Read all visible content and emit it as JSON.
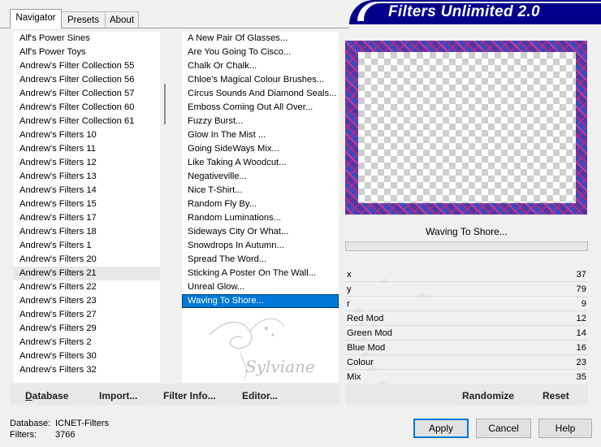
{
  "tabs": [
    {
      "label": "Navigator",
      "active": true
    },
    {
      "label": "Presets",
      "active": false
    },
    {
      "label": "About",
      "active": false
    }
  ],
  "banner": {
    "title": "Filters Unlimited 2.0"
  },
  "categories": {
    "items": [
      "Alf's Power Sines",
      "Alf's Power Toys",
      "Andrew's Filter Collection 55",
      "Andrew's Filter Collection 56",
      "Andrew's Filter Collection 57",
      "Andrew's Filter Collection 60",
      "Andrew's Filter Collection 61",
      "Andrew's Filters 10",
      "Andrew's Filters 11",
      "Andrew's Filters 12",
      "Andrew's Filters 13",
      "Andrew's Filters 14",
      "Andrew's Filters 15",
      "Andrew's Filters 17",
      "Andrew's Filters 18",
      "Andrew's Filters 1",
      "Andrew's Filters 20",
      "Andrew's Filters 21",
      "Andrew's Filters 22",
      "Andrew's Filters 23",
      "Andrew's Filters 27",
      "Andrew's Filters 29",
      "Andrew's Filters 2",
      "Andrew's Filters 30",
      "Andrew's Filters 32"
    ],
    "selected": "Andrew's Filters 21"
  },
  "filters": {
    "items": [
      "A New Pair Of Glasses...",
      "Are You Going To Cisco...",
      "Chalk Or Chalk...",
      "Chloe's Magical Colour Brushes...",
      "Circus Sounds And Diamond Seals...",
      "Emboss Coming Out All Over...",
      "Fuzzy Burst...",
      "Glow In The Mist ...",
      "Going SideWays Mix...",
      "Like Taking A Woodcut...",
      "Negativeville...",
      "Nice T-Shirt...",
      "Random Fly By...",
      "Random Luminations...",
      "Sideways City Or What...",
      "Snowdrops In Autumn...",
      "Spread The Word...",
      "Sticking A Poster On The Wall...",
      "Unreal Glow...",
      "Waving To Shore..."
    ],
    "selected": "Waving To Shore..."
  },
  "watermark": "Sylviane",
  "preview": {
    "filter_name": "Waving To Shore..."
  },
  "params": [
    {
      "label": "x",
      "value": "37",
      "fraction": 0.145
    },
    {
      "label": "y",
      "value": "79",
      "fraction": 0.31
    },
    {
      "label": "r",
      "value": "9",
      "fraction": 0.035
    },
    {
      "label": "Red Mod",
      "value": "12",
      "fraction": 0.047
    },
    {
      "label": "Green Mod",
      "value": "14",
      "fraction": 0.055
    },
    {
      "label": "Blue Mod",
      "value": "16",
      "fraction": 0.063
    },
    {
      "label": "Colour",
      "value": "23",
      "fraction": 0.09
    },
    {
      "label": "Mix",
      "value": "35",
      "fraction": 0.137
    }
  ],
  "buttons": {
    "database": "Database",
    "import": "Import...",
    "filter_info": "Filter Info...",
    "editor": "Editor...",
    "randomize": "Randomize",
    "reset": "Reset",
    "apply": "Apply",
    "cancel": "Cancel",
    "help": "Help"
  },
  "status": {
    "database_label": "Database:",
    "database_value": "ICNET-Filters",
    "filters_label": "Filters:",
    "filters_value": "3766"
  }
}
